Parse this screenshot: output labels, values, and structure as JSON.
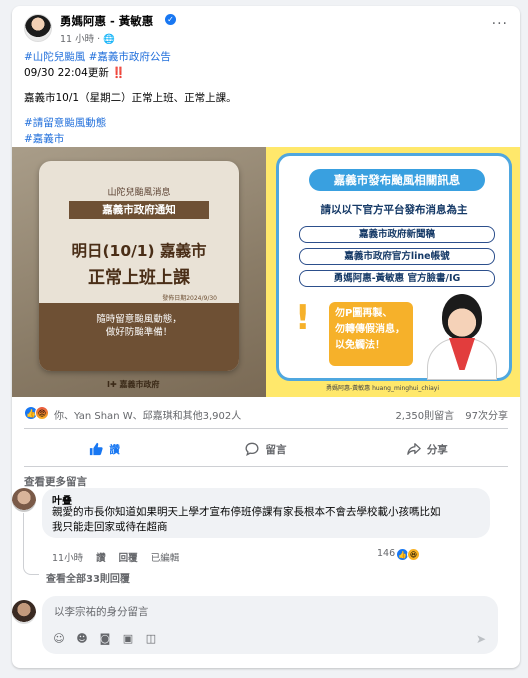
{
  "post": {
    "author": "勇媽阿惠 - 黃敏惠",
    "time": "11 小時",
    "privacy_icon": "globe-icon",
    "tags_line1": "#山陀兒颱風 #嘉義市政府公告",
    "update_line": "09/30 22:04更新",
    "update_mark": "‼️",
    "body_line": "嘉義市10/1（星期二）正常上班、正常上課。",
    "tag_line3": "#請留意颱風動態",
    "tag_line4": "#嘉義市"
  },
  "image_left": {
    "line1": "山陀兒颱風消息",
    "line2": "嘉義市政府通知",
    "line3": "明日(10/1) 嘉義市",
    "line4": "正常上班上課",
    "date": "發佈日期2024/9/30",
    "note1": "隨時留意颱風動態，",
    "note2": "做好防颱準備！",
    "footer": "I✚ 嘉義市政府"
  },
  "image_right": {
    "title": "嘉義市發布颱風相關訊息",
    "lead": "請以以下官方平台發布消息為主",
    "pills": [
      "嘉義市政府新聞稿",
      "嘉義市政府官方line帳號",
      "勇媽阿惠-黃敏惠 官方臉書/IG"
    ],
    "warn1": "勿P圖再製、",
    "warn2": "勿轉傳假消息，",
    "warn3": "以免觸法！",
    "footer": "勇媽阿惠-黃敏惠   huang_minghui_chiayi"
  },
  "reactions": {
    "summary": "你、Yan Shan W、邱嘉琪和其他3,902人",
    "comments": "2,350則留言",
    "shares": "97次分享"
  },
  "actions": {
    "like": "讚",
    "comment": "留言",
    "share": "分享"
  },
  "more_comments": "查看更多留言",
  "comment": {
    "author": "叶叠",
    "line1": "親愛的市長你知道如果明天上學才宣布停班停課有家長根本不會去學校載小孩嗎比如",
    "line2": "我只能走回家或待在超商",
    "time": "11小時",
    "like": "讚",
    "reply": "回覆",
    "edited": "已編輯",
    "reaction_count": "146"
  },
  "view_replies": "查看全部33則回覆",
  "composer": {
    "placeholder": "以李宗祐的身分留言"
  },
  "colors": {
    "brand": "#1877f2",
    "link": "#216fdb",
    "muted": "#65676b"
  }
}
